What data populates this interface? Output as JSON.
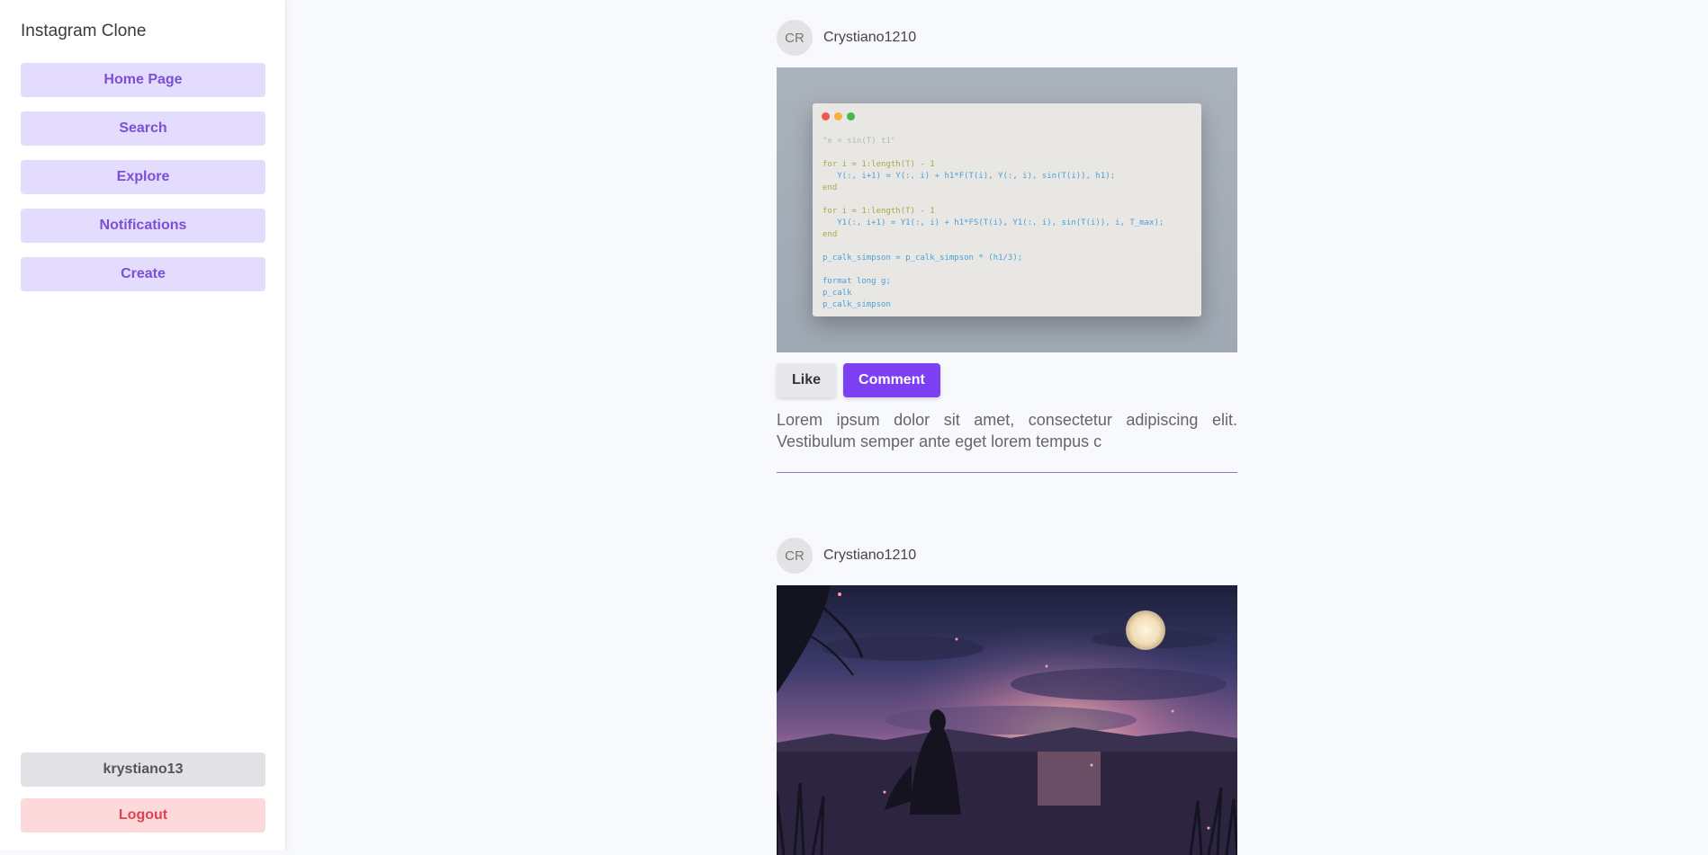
{
  "app": {
    "title": "Instagram Clone"
  },
  "sidebar": {
    "items": [
      {
        "label": "Home Page"
      },
      {
        "label": "Search"
      },
      {
        "label": "Explore"
      },
      {
        "label": "Notifications"
      },
      {
        "label": "Create"
      }
    ],
    "current_user": "krystiano13",
    "logout_label": "Logout"
  },
  "colors": {
    "accent": "#7d3ff2",
    "nav_bg": "#e3dcfd",
    "nav_text": "#7b4fd8",
    "logout_bg": "#fdd9dc",
    "logout_text": "#e0434f",
    "divider": "#9b6fd8"
  },
  "posts": [
    {
      "avatar_initials": "CR",
      "username": "Crystiano1210",
      "image_icon": "code-screenshot-image",
      "like_label": "Like",
      "comment_label": "Comment",
      "caption": "Lorem ipsum dolor sit amet, consectetur adipiscing elit. Vestibulum semper ante eget lorem tempus c",
      "code": {
        "line1": "\"e = sin(T) t1\"",
        "line2": "for i = 1:length(T) - 1",
        "line3": "   Y(:, i+1) = Y(:, i) + h1*F(T(i), Y(:, i), sin(T(i)), h1);",
        "line4": "end",
        "line5": "for i = 1:length(T) - 1",
        "line6": "   Y1(:, i+1) = Y1(:, i) + h1*FS(T(i), Y1(:, i), sin(T(i)), i, T_max);",
        "line7": "end",
        "line8": "p_calk_simpson = p_calk_simpson * (h1/3);",
        "line9": "format long g;",
        "line10": "p_calk",
        "line11": "p_calk_simpson"
      }
    },
    {
      "avatar_initials": "CR",
      "username": "Crystiano1210",
      "image_icon": "night-landscape-image"
    }
  ]
}
